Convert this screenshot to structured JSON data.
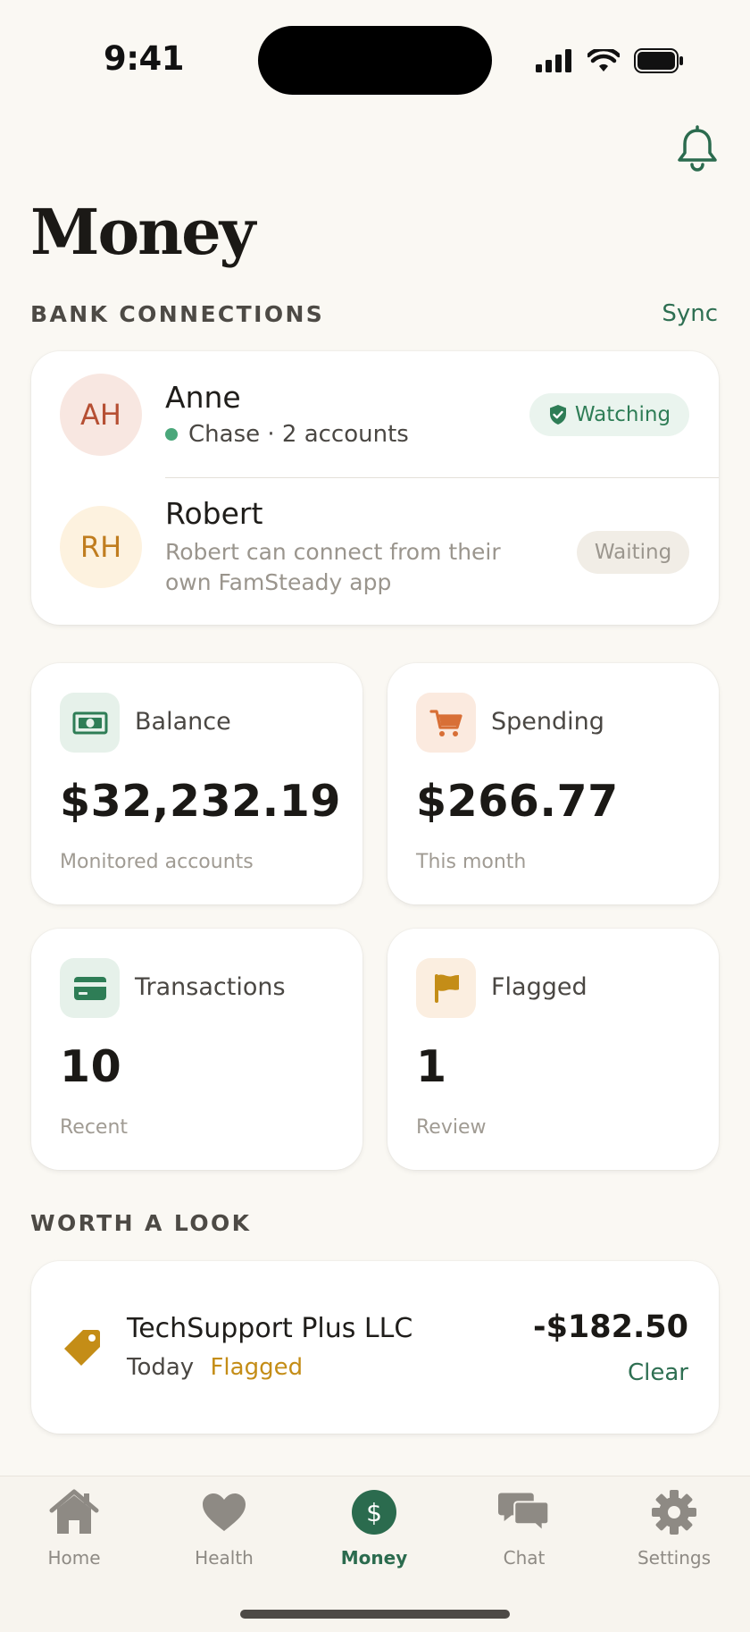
{
  "status_bar": {
    "time": "9:41"
  },
  "page": {
    "title": "Money"
  },
  "bank_connections": {
    "section_label": "BANK CONNECTIONS",
    "sync_label": "Sync",
    "members": [
      {
        "initials": "AH",
        "name": "Anne",
        "detail": "Chase · 2 accounts",
        "status": "Watching"
      },
      {
        "initials": "RH",
        "name": "Robert",
        "detail": "Robert can connect from their own FamSteady app",
        "status": "Waiting"
      }
    ]
  },
  "stats": [
    {
      "label": "Balance",
      "value": "$32,232.19",
      "sub": "Monitored accounts",
      "icon": "cash-icon",
      "icon_bg": "#e6f1ea",
      "icon_color": "#2e7d56"
    },
    {
      "label": "Spending",
      "value": "$266.77",
      "sub": "This month",
      "icon": "cart-icon",
      "icon_bg": "#fbeadf",
      "icon_color": "#d86f36"
    },
    {
      "label": "Transactions",
      "value": "10",
      "sub": "Recent",
      "icon": "card-icon",
      "icon_bg": "#e6f1ea",
      "icon_color": "#2e7d56"
    },
    {
      "label": "Flagged",
      "value": "1",
      "sub": "Review",
      "icon": "flag-icon",
      "icon_bg": "#fbeee0",
      "icon_color": "#c48d17"
    }
  ],
  "worth_a_look": {
    "section_label": "WORTH A LOOK",
    "items": [
      {
        "merchant": "TechSupport Plus LLC",
        "date": "Today",
        "flag": "Flagged",
        "amount": "-$182.50",
        "action": "Clear"
      }
    ]
  },
  "tab_bar": {
    "tabs": [
      {
        "label": "Home",
        "icon": "house-icon",
        "active": false
      },
      {
        "label": "Health",
        "icon": "heart-icon",
        "active": false
      },
      {
        "label": "Money",
        "icon": "dollar-icon",
        "active": true
      },
      {
        "label": "Chat",
        "icon": "chat-icon",
        "active": false
      },
      {
        "label": "Settings",
        "icon": "gear-icon",
        "active": false
      }
    ]
  },
  "colors": {
    "accent": "#2b6b4e",
    "background": "#faf8f3",
    "flag": "#c48d17"
  }
}
